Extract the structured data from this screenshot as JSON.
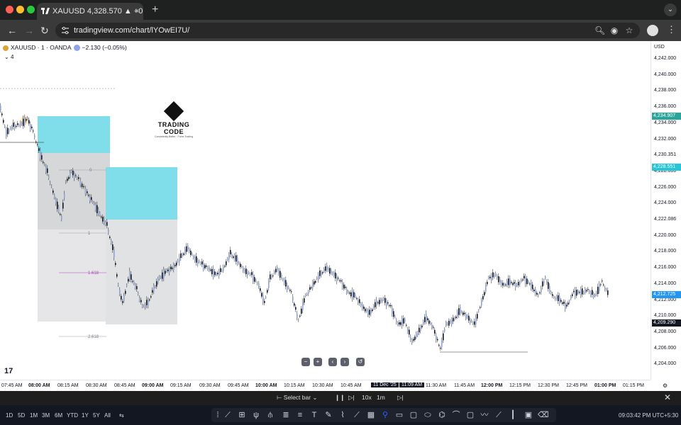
{
  "browser": {
    "tab_title": "XAUUSD 4,328.570 ▲ +0.55",
    "tab_close": "×",
    "new_tab": "+",
    "url": "tradingview.com/chart/lYOwEI7U/",
    "menu_chevron": "⌄"
  },
  "chart": {
    "symbol": "XAUUSD · 1 · OANDA",
    "change": "−2.130 (−0.05%)",
    "indicator_count": "4",
    "currency": "USD",
    "logo_name": "TRADING CODE",
    "logo_tagline": "Consistently Better · Forex Trading",
    "price_labels": [
      "4,242.000",
      "4,240.000",
      "4,238.000",
      "4,236.000",
      "4,234.000",
      "4,232.000",
      "4,230.351",
      "4,228.000",
      "4,226.000",
      "4,224.000",
      "4,222.086",
      "4,220.000",
      "4,218.000",
      "4,216.000",
      "4,214.000",
      "4,212.000",
      "4,210.000",
      "4,208.000",
      "4,206.000",
      "4,204.000"
    ],
    "price_tags": [
      {
        "text": "4,234.907",
        "color": "#26a69a"
      },
      {
        "text": "4,228.551",
        "color": "#26c6da"
      },
      {
        "text": "4,212.725",
        "color": "#2196f3"
      },
      {
        "text": "4,209.290",
        "color": "#131722"
      }
    ],
    "time_labels": [
      "07:45 AM",
      "08:00 AM",
      "08:15 AM",
      "08:30 AM",
      "08:45 AM",
      "09:00 AM",
      "09:15 AM",
      "09:30 AM",
      "09:45 AM",
      "10:00 AM",
      "10:15 AM",
      "10:30 AM",
      "10:45 AM",
      "11 Dec '25",
      "11:09 AM",
      "11:30 AM",
      "11:45 AM",
      "12:00 PM",
      "12:15 PM",
      "12:30 PM",
      "12:45 PM",
      "01:00 PM",
      "01:15 PM"
    ],
    "fib_labels": [
      "0",
      "1",
      "1.618",
      "2.618"
    ],
    "tv_badge": "17"
  },
  "replay_bar": {
    "select_bar": "Select bar",
    "speed": "10x",
    "interval": "1m"
  },
  "toolbar": {
    "timeframes": [
      "1D",
      "5D",
      "1M",
      "3M",
      "6M",
      "YTD",
      "1Y",
      "5Y",
      "All"
    ],
    "clock": "09:03:42 PM UTC+5:30"
  }
}
